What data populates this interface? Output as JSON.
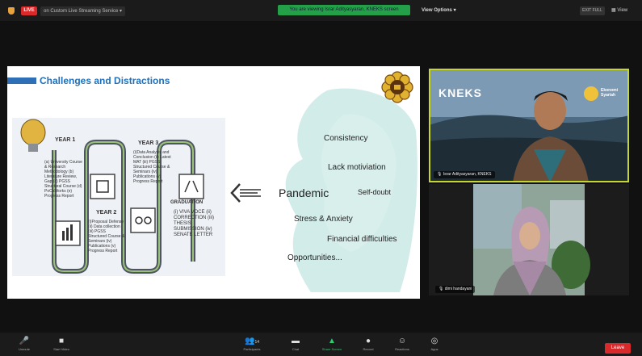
{
  "topbar": {
    "live_badge": "LIVE",
    "stream_label": "on Custom Live Streaming Service",
    "share_banner": "You are viewing Israr Adityasyaran, KNEKS screen",
    "view_options": "View Options",
    "exit_fullscreen": "EXIT FULL",
    "view": "View"
  },
  "slide": {
    "title": "Challenges and Distractions",
    "roadmap": {
      "year1": "YEAR 1",
      "year1_items": "(a) University Course & Research Methodology (b) Literature Review, Gap (c) PGSS Structural Course (d) PoCaWorks (e) Progress Report",
      "year2": "YEAR 2",
      "year2_items": "(i)Proposal Defense (ii) Data collection (iii) PGSS Structured Course & Seminars (iv) Publications (v) Progress Report",
      "year3": "YEAR 3",
      "year3_items": "(i)Data Analysis and Conclusion (ii) Latest MAT (iii) PGSS Structured Course & Seminars (iv) Publications (v) Progress Report",
      "graduation": "GRADUATION",
      "graduation_items": "(i) VIVA VOCE (ii) CORRECTION (iii) THESIS SUBMISSION (iv) SENATE LETTER"
    },
    "words": {
      "consistency": "Consistency",
      "lack_motivation": "Lack motiviation",
      "pandemic": "Pandemic",
      "self_doubt": "Self-doubt",
      "stress": "Stress & Anxiety",
      "financial": "Financial difficulties",
      "opportunities": "Opportunities..."
    }
  },
  "cameras": {
    "cam1_logo": "KNEKS",
    "cam1_brand": "Ekonomi Syariah",
    "cam1_name": "Israr Adityasyaran, KNEKS",
    "cam2_name": "dimi handayani"
  },
  "toolbar": {
    "unmute": "Unmute",
    "start_video": "Start Video",
    "participants": "Participants",
    "participants_count": "14",
    "chat": "Chat",
    "share_screen": "Share Screen",
    "record": "Record",
    "reactions": "Reactions",
    "apps": "Apps",
    "leave": "Leave"
  },
  "colors": {
    "live_red": "#d9292b",
    "banner_green": "#24a148",
    "title_blue": "#1f6fb9",
    "active_speaker": "#c6d62c"
  }
}
